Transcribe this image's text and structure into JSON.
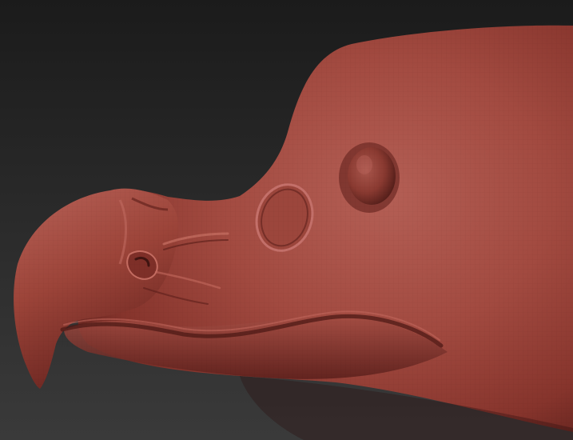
{
  "scene": {
    "subject": "sculpted-bird-head",
    "colors": {
      "background_top": "#1b1b1b",
      "background_mid": "#2c2c2c",
      "background_bottom": "#3a3a3a",
      "clay_light": "#b55d53",
      "clay_mid": "#9a4238",
      "clay_dark": "#6b2621",
      "clay_shadow": "#4a1814"
    }
  }
}
